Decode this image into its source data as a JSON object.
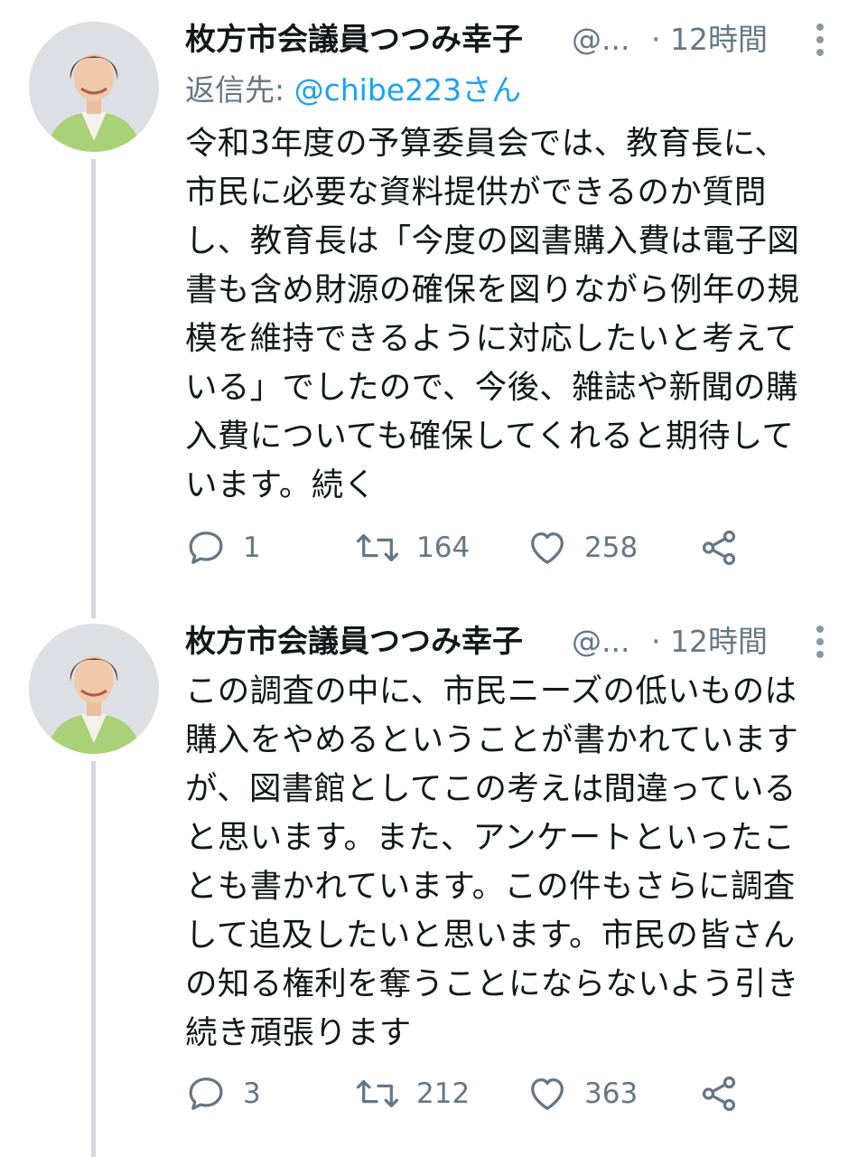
{
  "colors": {
    "text": "#14171a",
    "secondary": "#657786",
    "accent": "#1da1f2",
    "thread_line": "#d3d8dc"
  },
  "tweets": [
    {
      "author_name": "枚方市会議員つつみ幸子",
      "author_handle": "@...",
      "time": "· 12時間",
      "reply_to_prefix": "返信先: ",
      "reply_to_mention": "@chibe223さん",
      "body_lines": [
        "令和3年度の予算委員会では、教育長に、",
        "市民に必要な資料提供ができるのか質問",
        "し、教育長は「今度の図書購入費は電子図",
        "書も含め財源の確保を図りながら例年の規",
        "模を維持できるように対応したいと考えて",
        "いる」でしたので、今後、雑誌や新聞の購",
        "入費についても確保してくれると期待して",
        "います。続く"
      ],
      "replies": "1",
      "retweets": "164",
      "likes": "258"
    },
    {
      "author_name": "枚方市会議員つつみ幸子",
      "author_handle": "@...",
      "time": "· 12時間",
      "body_lines": [
        "この調査の中に、市民ニーズの低いものは",
        "購入をやめるということが書かれています",
        "が、図書館としてこの考えは間違っている",
        "と思います。また、アンケートといったこ",
        "とも書かれています。この件もさらに調査",
        "して追及したいと思います。市民の皆さん",
        "の知る権利を奪うことにならないよう引き",
        "続き頑張ります"
      ],
      "replies": "3",
      "retweets": "212",
      "likes": "363"
    }
  ]
}
